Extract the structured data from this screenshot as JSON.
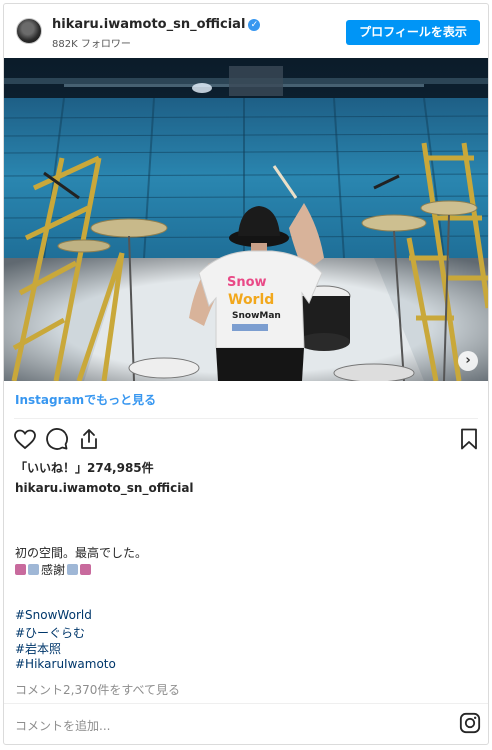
{
  "header": {
    "username": "hikaru.iwamoto_sn_official",
    "verified_icon": "verified-badge-icon",
    "followers": "882K フォロワー",
    "profile_button": "プロフィールを表示"
  },
  "photo": {
    "shirt_line1": "Snow",
    "shirt_line2": "World",
    "shirt_line3": "SnowMan",
    "next_icon": "chevron-right-icon"
  },
  "view_more_link": "Instagramでもっと見る",
  "actions": {
    "like_icon": "heart-icon",
    "comment_icon": "comment-icon",
    "share_icon": "share-icon",
    "save_icon": "bookmark-icon"
  },
  "likes_text": "「いいね！」274,985件",
  "caption": {
    "username": "hikaru.iwamoto_sn_official",
    "line1": "初の空間。最高でした。",
    "line2_text": "感謝",
    "hashtags": [
      "#SnowWorld",
      "#ひーぐらむ",
      "#岩本照",
      "#HikaruIwamoto"
    ]
  },
  "comments_link": "コメント2,370件をすべて見る",
  "comment_placeholder": "コメントを追加...",
  "footer_icon": "instagram-icon",
  "colors": {
    "accent": "#0095f6",
    "link": "#3897f0",
    "hashtag": "#00376b"
  }
}
